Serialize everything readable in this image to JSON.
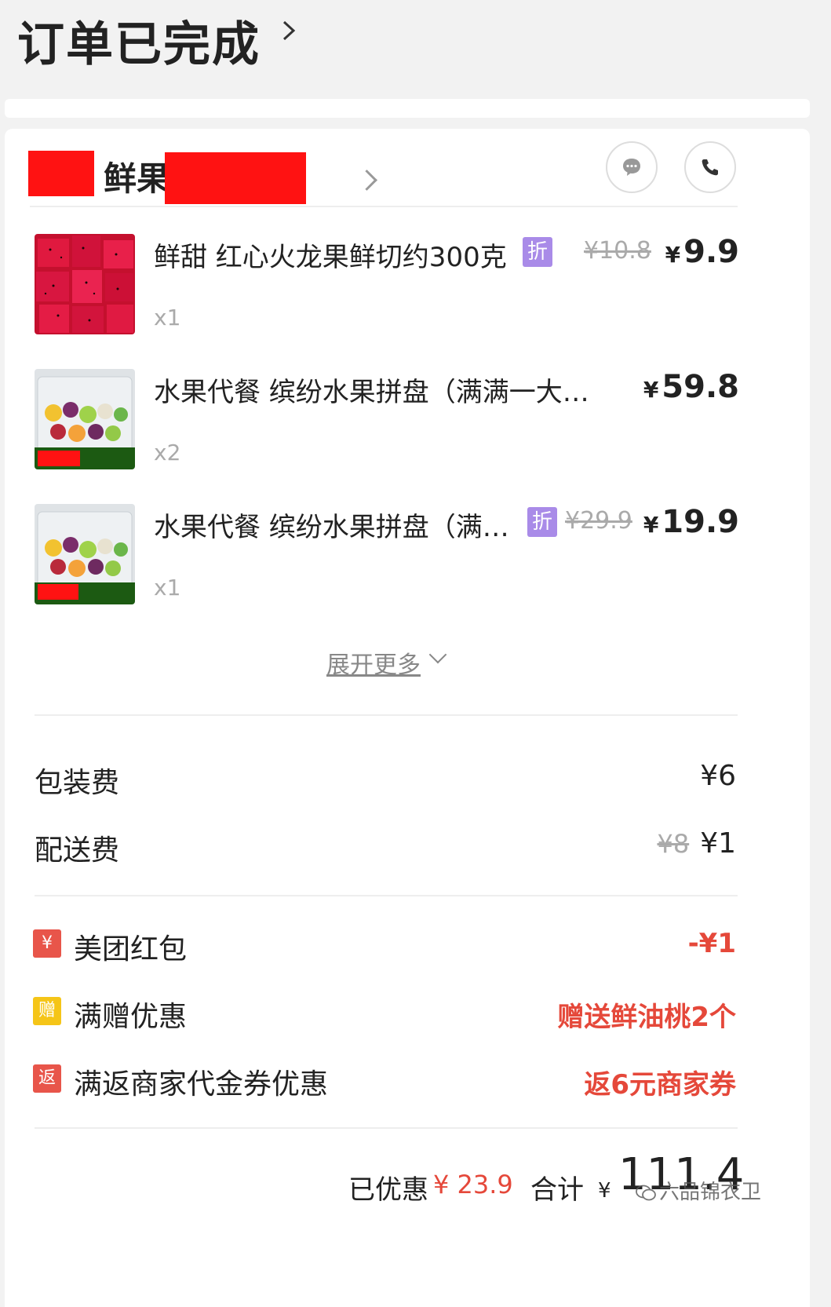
{
  "header": {
    "title": "订单已完成"
  },
  "shop": {
    "name": "鲜果"
  },
  "items": [
    {
      "name": "鲜甜 红心火龙果鲜切约300克",
      "qty": "x1",
      "tag": "折",
      "original_price": "¥10.8",
      "price_symbol": "¥",
      "price": "9.9"
    },
    {
      "name": "水果代餐 缤纷水果拼盘（满满一大…",
      "qty": "x2",
      "price_symbol": "¥",
      "price": "59.8"
    },
    {
      "name": "水果代餐 缤纷水果拼盘（满…",
      "qty": "x1",
      "tag": "折",
      "original_price": "¥29.9",
      "price_symbol": "¥",
      "price": "19.9"
    }
  ],
  "expand_more": "展开更多",
  "fees": [
    {
      "label": "包装费",
      "value": "¥6"
    },
    {
      "label": "配送费",
      "original": "¥8",
      "value": "¥1"
    }
  ],
  "discounts": [
    {
      "icon_text": "¥",
      "icon_color": "#e8554a",
      "label": "美团红包",
      "value": "-¥1"
    },
    {
      "icon_text": "赠",
      "icon_color": "#f5c518",
      "label": "满赠优惠",
      "value": "赠送鲜油桃2个"
    },
    {
      "icon_text": "返",
      "icon_color": "#e8554a",
      "label": "满返商家代金券优惠",
      "value": "返6元商家券"
    }
  ],
  "summary": {
    "saved_label": "已优惠",
    "saved_value": "¥ 23.9",
    "total_label": "合计",
    "total_symbol": "¥",
    "total_value": "111.4"
  },
  "watermark": "六品锦衣卫",
  "colors": {
    "accent_red": "#e5483a",
    "tag_purple": "#a98be8",
    "redaction": "#ff1212"
  }
}
